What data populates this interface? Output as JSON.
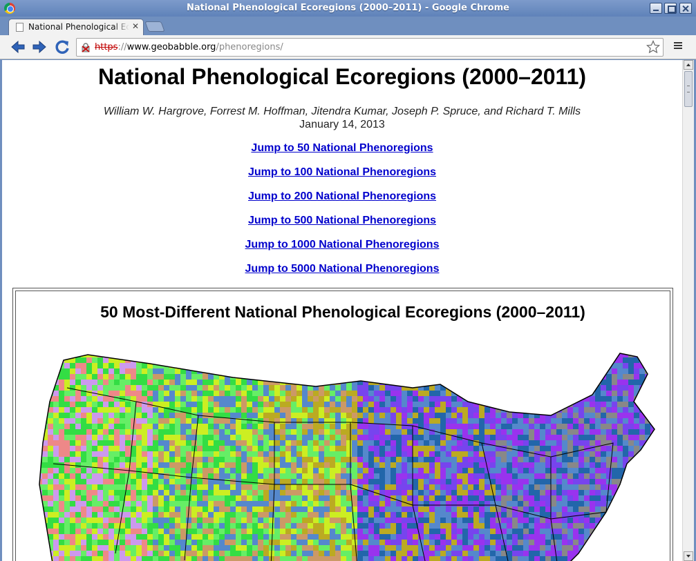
{
  "window": {
    "title": "National Phenological Ecoregions (2000–2011) - Google Chrome"
  },
  "tabs": [
    {
      "label": "National Phenological Ecoregions (2000–2011)"
    }
  ],
  "toolbar": {
    "url_scheme": "https",
    "url_separator": "://",
    "url_host": "www.geobabble.org",
    "url_path": "/phenoregions/"
  },
  "page": {
    "title": "National Phenological Ecoregions (2000–2011)",
    "authors": "William W. Hargrove, Forrest M. Hoffman, Jitendra Kumar, Joseph P. Spruce, and Richard T. Mills",
    "date": "January 14, 2013",
    "jump_links": [
      {
        "label": "Jump to 50 National Phenoregions"
      },
      {
        "label": "Jump to 100 National Phenoregions"
      },
      {
        "label": "Jump to 200 National Phenoregions"
      },
      {
        "label": "Jump to 500 National Phenoregions"
      },
      {
        "label": "Jump to 1000 National Phenoregions"
      },
      {
        "label": "Jump to 5000 National Phenoregions"
      }
    ],
    "figure": {
      "title": "50 Most-Different National Phenological Ecoregions (2000–2011)",
      "map_colors": [
        "#33dd44",
        "#2266aa",
        "#ccee22",
        "#7744ee",
        "#cc9966",
        "#bbaa22",
        "#5588cc",
        "#ee8888",
        "#cc99ee",
        "#66ee66",
        "#9933ee",
        "#888888"
      ]
    }
  }
}
